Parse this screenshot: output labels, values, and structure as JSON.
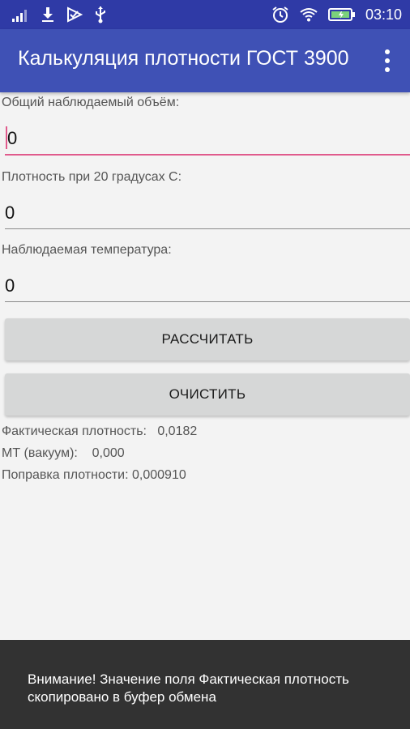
{
  "status_bar": {
    "time": "03:10",
    "icons": [
      "signal-icon",
      "download-icon",
      "checklist-icon",
      "usb-icon",
      "alarm-icon",
      "wifi-icon",
      "battery-charging-icon"
    ]
  },
  "toolbar": {
    "title": "Калькуляция плотности ГОСТ 3900",
    "menu_icon": "overflow-menu-icon"
  },
  "form": {
    "volume": {
      "label": "Общий наблюдаемый объём:",
      "value": "0"
    },
    "density20": {
      "label": "Плотность при 20 градусах С:",
      "value": "0"
    },
    "temperature": {
      "label": "Наблюдаемая температура:",
      "value": "0"
    }
  },
  "buttons": {
    "calculate": "РАССЧИТАТЬ",
    "clear": "ОЧИСТИТЬ"
  },
  "results": {
    "actual_density": "Фактическая плотность:   0,0182",
    "mt_vacuum": "МТ (вакуум):    0,000",
    "density_correction": "Поправка плотности: 0,000910"
  },
  "snackbar": {
    "message": "Внимание! Значение поля Фактическая плотность скопировано в буфер обмена"
  },
  "colors": {
    "status_bar": "#2f3aa6",
    "toolbar": "#3f51b5",
    "accent": "#e05a8c",
    "button": "#d6d7d7",
    "snackbar": "#323232"
  }
}
